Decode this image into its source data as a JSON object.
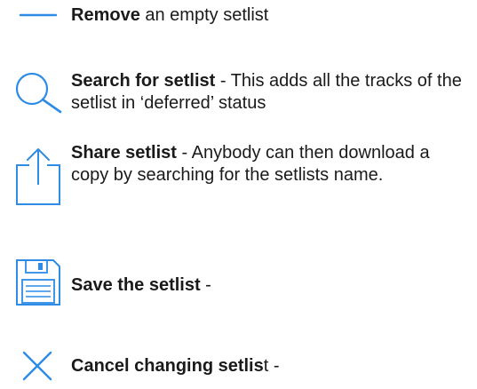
{
  "colors": {
    "accent": "#2E8BE6",
    "text": "#1a1a1a"
  },
  "items": [
    {
      "icon": "minus-icon",
      "bold": "Remove",
      "rest": " an empty setlist"
    },
    {
      "icon": "search-icon",
      "bold": "Search for setlist",
      "rest": " - This adds all the tracks of the setlist in ‘deferred’ status"
    },
    {
      "icon": "share-icon",
      "bold": "Share setlist",
      "rest": " - Anybody can then download a copy by searching for the setlists name."
    },
    {
      "icon": "save-icon",
      "bold": "Save the setlist",
      "rest": " -"
    },
    {
      "icon": "close-icon",
      "bold": "Cancel changing setlis",
      "rest": "t -"
    }
  ]
}
